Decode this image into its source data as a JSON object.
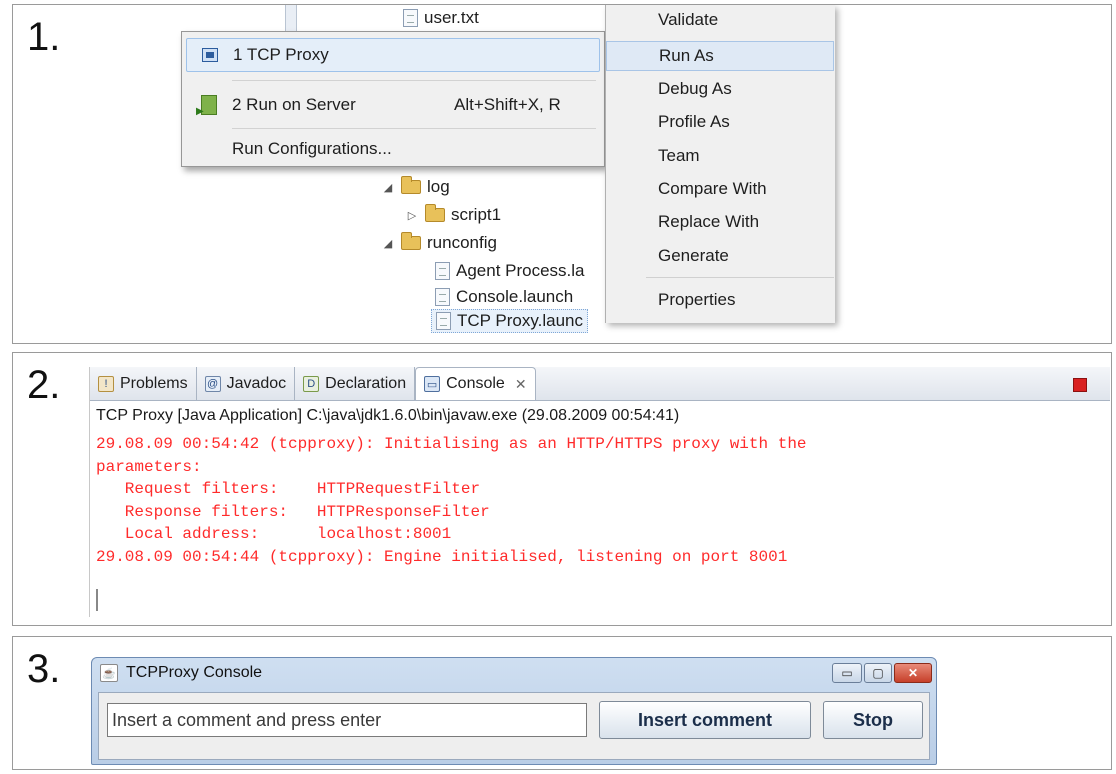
{
  "steps": {
    "one": "1.",
    "two": "2.",
    "three": "3."
  },
  "panel1": {
    "tree": {
      "user_txt": "user.txt",
      "log": "log",
      "script1": "script1",
      "runconfig": "runconfig",
      "agent": "Agent Process.la",
      "console_launch": "Console.launch",
      "tcp_launch": "TCP Proxy.launc"
    },
    "run_submenu": {
      "item1": "1 TCP Proxy",
      "item2": "2 Run on Server",
      "item2_accel": "Alt+Shift+X, R",
      "item3": "Run Configurations..."
    },
    "context_menu": [
      "Validate",
      "Run As",
      "Debug As",
      "Profile As",
      "Team",
      "Compare With",
      "Replace With",
      "Generate",
      "Properties"
    ]
  },
  "panel2": {
    "tabs": [
      "Problems",
      "Javadoc",
      "Declaration",
      "Console"
    ],
    "close_glyph": "✕",
    "launch_line": "TCP Proxy [Java Application] C:\\java\\jdk1.6.0\\bin\\javaw.exe (29.08.2009 00:54:41)",
    "output": [
      "29.08.09 00:54:42 (tcpproxy): Initialising as an HTTP/HTTPS proxy with the",
      "parameters:",
      "   Request filters:    HTTPRequestFilter",
      "   Response filters:   HTTPResponseFilter",
      "   Local address:      localhost:8001",
      "29.08.09 00:54:44 (tcpproxy): Engine initialised, listening on port 8001"
    ]
  },
  "panel3": {
    "title": "TCPProxy Console",
    "input_placeholder": "Insert a comment and press enter",
    "insert_button": "Insert comment",
    "stop_button": "Stop",
    "min_glyph": "▭",
    "max_glyph": "▢",
    "close_glyph": "✕"
  }
}
